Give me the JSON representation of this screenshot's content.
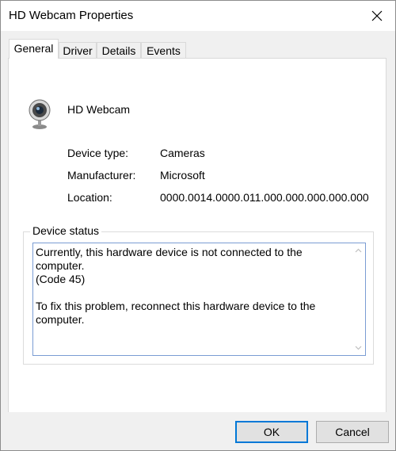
{
  "window": {
    "title": "HD Webcam Properties",
    "close_icon": "close-icon"
  },
  "tabs": [
    {
      "label": "General",
      "active": true
    },
    {
      "label": "Driver",
      "active": false
    },
    {
      "label": "Details",
      "active": false
    },
    {
      "label": "Events",
      "active": false
    }
  ],
  "device": {
    "icon": "webcam-icon",
    "name": "HD Webcam"
  },
  "properties": [
    {
      "label": "Device type:",
      "value": "Cameras"
    },
    {
      "label": "Manufacturer:",
      "value": "Microsoft"
    },
    {
      "label": "Location:",
      "value": "0000.0014.0000.011.000.000.000.000.000"
    }
  ],
  "device_status": {
    "legend": "Device status",
    "text": "Currently, this hardware device is not connected to the computer.\n(Code 45)\n\nTo fix this problem, reconnect this hardware device to the\ncomputer."
  },
  "buttons": {
    "ok": "OK",
    "cancel": "Cancel"
  },
  "colors": {
    "accent": "#0078d7",
    "dialog_bg": "#f0f0f0",
    "panel_bg": "#ffffff"
  }
}
